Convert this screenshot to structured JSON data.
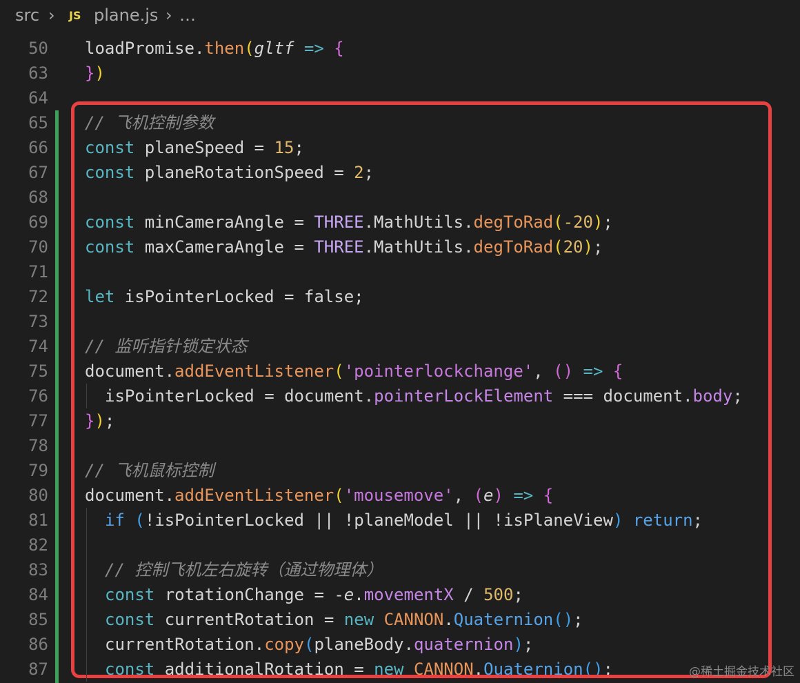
{
  "breadcrumb": {
    "folder": "src",
    "file_icon": "JS",
    "file": "plane.js",
    "more": "…",
    "separator": "›"
  },
  "colors": {
    "keyword_decl": "#57b6c2",
    "variable": "#d4d4d4",
    "number": "#e0b96b",
    "string": "#c678dd",
    "function": "#e8955b",
    "class": "#c8a8f4",
    "property": "#c586e6",
    "comment": "#8a8a8a",
    "paren_gold": "#f2d230",
    "paren_pink": "#d16ad8",
    "paren_blue": "#3e9ee8",
    "flow_keyword": "#57a3e8",
    "diff_added": "#3fa05a",
    "highlight_border": "#e84141"
  },
  "lines": [
    {
      "num": "50",
      "indent": 0,
      "tokens": [
        [
          "loadPromise",
          "var"
        ],
        [
          ".",
          "var"
        ],
        [
          "then",
          "fn"
        ],
        [
          "(",
          "pg"
        ],
        [
          "gltf",
          "param"
        ],
        [
          " ",
          "var"
        ],
        [
          "=>",
          "kw"
        ],
        [
          " ",
          "var"
        ],
        [
          "{",
          "pp"
        ]
      ]
    },
    {
      "num": "63",
      "indent": 0,
      "tokens": [
        [
          "}",
          "pp"
        ],
        [
          ")",
          "pg"
        ]
      ]
    },
    {
      "num": "64",
      "indent": 0,
      "tokens": []
    },
    {
      "num": "65",
      "indent": 0,
      "tokens": [
        [
          "// 飞机控制参数",
          "cm"
        ]
      ]
    },
    {
      "num": "66",
      "indent": 0,
      "tokens": [
        [
          "const",
          "kw"
        ],
        [
          " planeSpeed = ",
          "var"
        ],
        [
          "15",
          "num"
        ],
        [
          ";",
          "var"
        ]
      ]
    },
    {
      "num": "67",
      "indent": 0,
      "tokens": [
        [
          "const",
          "kw"
        ],
        [
          " planeRotationSpeed = ",
          "var"
        ],
        [
          "2",
          "num"
        ],
        [
          ";",
          "var"
        ]
      ]
    },
    {
      "num": "68",
      "indent": 0,
      "tokens": []
    },
    {
      "num": "69",
      "indent": 0,
      "tokens": [
        [
          "const",
          "kw"
        ],
        [
          " minCameraAngle = ",
          "var"
        ],
        [
          "THREE",
          "cls"
        ],
        [
          ".MathUtils.",
          "var"
        ],
        [
          "degToRad",
          "fn"
        ],
        [
          "(",
          "pg"
        ],
        [
          "-20",
          "num"
        ],
        [
          ")",
          "pg"
        ],
        [
          ";",
          "var"
        ]
      ]
    },
    {
      "num": "70",
      "indent": 0,
      "tokens": [
        [
          "const",
          "kw"
        ],
        [
          " maxCameraAngle = ",
          "var"
        ],
        [
          "THREE",
          "cls"
        ],
        [
          ".MathUtils.",
          "var"
        ],
        [
          "degToRad",
          "fn"
        ],
        [
          "(",
          "pg"
        ],
        [
          "20",
          "num"
        ],
        [
          ")",
          "pg"
        ],
        [
          ";",
          "var"
        ]
      ]
    },
    {
      "num": "71",
      "indent": 0,
      "tokens": []
    },
    {
      "num": "72",
      "indent": 0,
      "tokens": [
        [
          "let",
          "kw"
        ],
        [
          " isPointerLocked = false;",
          "var"
        ]
      ]
    },
    {
      "num": "73",
      "indent": 0,
      "tokens": []
    },
    {
      "num": "74",
      "indent": 0,
      "tokens": [
        [
          "// 监听指针锁定状态",
          "cm"
        ]
      ]
    },
    {
      "num": "75",
      "indent": 0,
      "tokens": [
        [
          "document.",
          "var"
        ],
        [
          "addEventListener",
          "fn"
        ],
        [
          "(",
          "pg"
        ],
        [
          "'pointerlockchange'",
          "str"
        ],
        [
          ", ",
          "var"
        ],
        [
          "()",
          "pp"
        ],
        [
          " ",
          "var"
        ],
        [
          "=>",
          "kw"
        ],
        [
          " ",
          "var"
        ],
        [
          "{",
          "pp"
        ]
      ]
    },
    {
      "num": "76",
      "indent": 1,
      "tokens": [
        [
          "isPointerLocked = document.",
          "var"
        ],
        [
          "pointerLockElement",
          "prop"
        ],
        [
          " === document.",
          "var"
        ],
        [
          "body",
          "prop"
        ],
        [
          ";",
          "var"
        ]
      ]
    },
    {
      "num": "77",
      "indent": 0,
      "tokens": [
        [
          "}",
          "pp"
        ],
        [
          ")",
          "pg"
        ],
        [
          ";",
          "var"
        ]
      ]
    },
    {
      "num": "78",
      "indent": 0,
      "tokens": []
    },
    {
      "num": "79",
      "indent": 0,
      "tokens": [
        [
          "// 飞机鼠标控制",
          "cm"
        ]
      ]
    },
    {
      "num": "80",
      "indent": 0,
      "tokens": [
        [
          "document.",
          "var"
        ],
        [
          "addEventListener",
          "fn"
        ],
        [
          "(",
          "pg"
        ],
        [
          "'mousemove'",
          "str"
        ],
        [
          ", ",
          "var"
        ],
        [
          "(",
          "pp"
        ],
        [
          "e",
          "param"
        ],
        [
          ")",
          "pp"
        ],
        [
          " ",
          "var"
        ],
        [
          "=>",
          "kw"
        ],
        [
          " ",
          "var"
        ],
        [
          "{",
          "pp"
        ]
      ]
    },
    {
      "num": "81",
      "indent": 1,
      "tokens": [
        [
          "if",
          "flow"
        ],
        [
          " ",
          "var"
        ],
        [
          "(",
          "pb"
        ],
        [
          "!isPointerLocked || !planeModel || !isPlaneView",
          "var"
        ],
        [
          ")",
          "pb"
        ],
        [
          " ",
          "var"
        ],
        [
          "return",
          "flow"
        ],
        [
          ";",
          "var"
        ]
      ]
    },
    {
      "num": "82",
      "indent": 0,
      "tokens": []
    },
    {
      "num": "83",
      "indent": 1,
      "tokens": [
        [
          "// 控制飞机左右旋转（通过物理体）",
          "cm"
        ]
      ]
    },
    {
      "num": "84",
      "indent": 1,
      "tokens": [
        [
          "const",
          "kw"
        ],
        [
          " rotationChange = -",
          "var"
        ],
        [
          "e",
          "param"
        ],
        [
          ".",
          "var"
        ],
        [
          "movementX",
          "prop"
        ],
        [
          " / ",
          "var"
        ],
        [
          "500",
          "num"
        ],
        [
          ";",
          "var"
        ]
      ]
    },
    {
      "num": "85",
      "indent": 1,
      "tokens": [
        [
          "const",
          "kw"
        ],
        [
          " currentRotation = ",
          "var"
        ],
        [
          "new",
          "kw"
        ],
        [
          " ",
          "var"
        ],
        [
          "CANNON",
          "fn"
        ],
        [
          ".",
          "var"
        ],
        [
          "Quaternion",
          "flow"
        ],
        [
          "()",
          "pb"
        ],
        [
          ";",
          "var"
        ]
      ]
    },
    {
      "num": "86",
      "indent": 1,
      "tokens": [
        [
          "currentRotation.",
          "var"
        ],
        [
          "copy",
          "fn"
        ],
        [
          "(",
          "pb"
        ],
        [
          "planeBody.",
          "var"
        ],
        [
          "quaternion",
          "prop"
        ],
        [
          ")",
          "pb"
        ],
        [
          ";",
          "var"
        ]
      ]
    },
    {
      "num": "87",
      "indent": 1,
      "tokens": [
        [
          "const",
          "kw"
        ],
        [
          " additionalRotation = ",
          "var"
        ],
        [
          "new",
          "kw"
        ],
        [
          " ",
          "var"
        ],
        [
          "CANNON",
          "fn"
        ],
        [
          ".",
          "var"
        ],
        [
          "Quaternion",
          "flow"
        ],
        [
          "()",
          "pb"
        ],
        [
          ";",
          "var"
        ]
      ]
    }
  ],
  "watermark": "@稀土掘金技术社区"
}
